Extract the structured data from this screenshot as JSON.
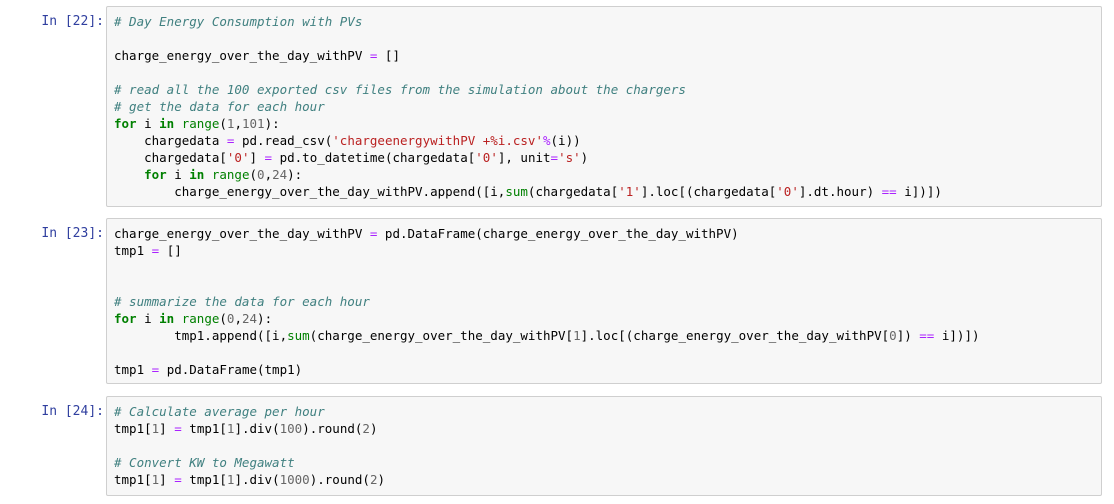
{
  "cells": [
    {
      "prompt": "In [22]:",
      "lines": [
        [
          [
            "c",
            "# Day Energy Consumption with PVs"
          ]
        ],
        [],
        [
          [
            "p",
            "charge_energy_over_the_day_withPV "
          ],
          [
            "o",
            "="
          ],
          [
            "p",
            " []"
          ]
        ],
        [],
        [
          [
            "c",
            "# read all the 100 exported csv files from the simulation about the chargers"
          ]
        ],
        [
          [
            "c",
            "# get the data for each hour"
          ]
        ],
        [
          [
            "k",
            "for"
          ],
          [
            "p",
            " i "
          ],
          [
            "k",
            "in"
          ],
          [
            "p",
            " "
          ],
          [
            "n",
            "range"
          ],
          [
            "p",
            "("
          ],
          [
            "m",
            "1"
          ],
          [
            "p",
            ","
          ],
          [
            "m",
            "101"
          ],
          [
            "p",
            "):"
          ]
        ],
        [
          [
            "p",
            "    chargedata "
          ],
          [
            "o",
            "="
          ],
          [
            "p",
            " pd.read_csv("
          ],
          [
            "s",
            "'chargeenergywithPV +%i.csv'"
          ],
          [
            "o",
            "%"
          ],
          [
            "p",
            "(i))"
          ]
        ],
        [
          [
            "p",
            "    chargedata["
          ],
          [
            "s",
            "'0'"
          ],
          [
            "p",
            "] "
          ],
          [
            "o",
            "="
          ],
          [
            "p",
            " pd.to_datetime(chargedata["
          ],
          [
            "s",
            "'0'"
          ],
          [
            "p",
            "], unit"
          ],
          [
            "o",
            "="
          ],
          [
            "s",
            "'s'"
          ],
          [
            "p",
            ")"
          ]
        ],
        [
          [
            "p",
            "    "
          ],
          [
            "k",
            "for"
          ],
          [
            "p",
            " i "
          ],
          [
            "k",
            "in"
          ],
          [
            "p",
            " "
          ],
          [
            "n",
            "range"
          ],
          [
            "p",
            "("
          ],
          [
            "m",
            "0"
          ],
          [
            "p",
            ","
          ],
          [
            "m",
            "24"
          ],
          [
            "p",
            "):"
          ]
        ],
        [
          [
            "p",
            "        charge_energy_over_the_day_withPV.append([i,"
          ],
          [
            "n",
            "sum"
          ],
          [
            "p",
            "(chargedata["
          ],
          [
            "s",
            "'1'"
          ],
          [
            "p",
            "].loc[(chargedata["
          ],
          [
            "s",
            "'0'"
          ],
          [
            "p",
            "].dt.hour) "
          ],
          [
            "o",
            "=="
          ],
          [
            "p",
            " i])])"
          ]
        ]
      ]
    },
    {
      "prompt": "In [23]:",
      "lines": [
        [
          [
            "p",
            "charge_energy_over_the_day_withPV "
          ],
          [
            "o",
            "="
          ],
          [
            "p",
            " pd.DataFrame(charge_energy_over_the_day_withPV)"
          ]
        ],
        [
          [
            "p",
            "tmp1 "
          ],
          [
            "o",
            "="
          ],
          [
            "p",
            " []"
          ]
        ],
        [],
        [],
        [
          [
            "c",
            "# summarize the data for each hour"
          ]
        ],
        [
          [
            "k",
            "for"
          ],
          [
            "p",
            " i "
          ],
          [
            "k",
            "in"
          ],
          [
            "p",
            " "
          ],
          [
            "n",
            "range"
          ],
          [
            "p",
            "("
          ],
          [
            "m",
            "0"
          ],
          [
            "p",
            ","
          ],
          [
            "m",
            "24"
          ],
          [
            "p",
            "):"
          ]
        ],
        [
          [
            "p",
            "        tmp1.append([i,"
          ],
          [
            "n",
            "sum"
          ],
          [
            "p",
            "(charge_energy_over_the_day_withPV["
          ],
          [
            "m",
            "1"
          ],
          [
            "p",
            "].loc[(charge_energy_over_the_day_withPV["
          ],
          [
            "m",
            "0"
          ],
          [
            "p",
            "]) "
          ],
          [
            "o",
            "=="
          ],
          [
            "p",
            " i])])"
          ]
        ],
        [],
        [
          [
            "p",
            "tmp1 "
          ],
          [
            "o",
            "="
          ],
          [
            "p",
            " pd.DataFrame(tmp1)"
          ]
        ]
      ]
    },
    {
      "prompt": "In [24]:",
      "lines": [
        [
          [
            "c",
            "# Calculate average per hour"
          ]
        ],
        [
          [
            "p",
            "tmp1["
          ],
          [
            "m",
            "1"
          ],
          [
            "p",
            "] "
          ],
          [
            "o",
            "="
          ],
          [
            "p",
            " tmp1["
          ],
          [
            "m",
            "1"
          ],
          [
            "p",
            "].div("
          ],
          [
            "m",
            "100"
          ],
          [
            "p",
            ").round("
          ],
          [
            "m",
            "2"
          ],
          [
            "p",
            ")"
          ]
        ],
        [],
        [
          [
            "c",
            "# Convert KW to Megawatt"
          ]
        ],
        [
          [
            "p",
            "tmp1["
          ],
          [
            "m",
            "1"
          ],
          [
            "p",
            "] "
          ],
          [
            "o",
            "="
          ],
          [
            "p",
            " tmp1["
          ],
          [
            "m",
            "1"
          ],
          [
            "p",
            "].div("
          ],
          [
            "m",
            "1000"
          ],
          [
            "p",
            ").round("
          ],
          [
            "m",
            "2"
          ],
          [
            "p",
            ")"
          ]
        ]
      ]
    }
  ]
}
